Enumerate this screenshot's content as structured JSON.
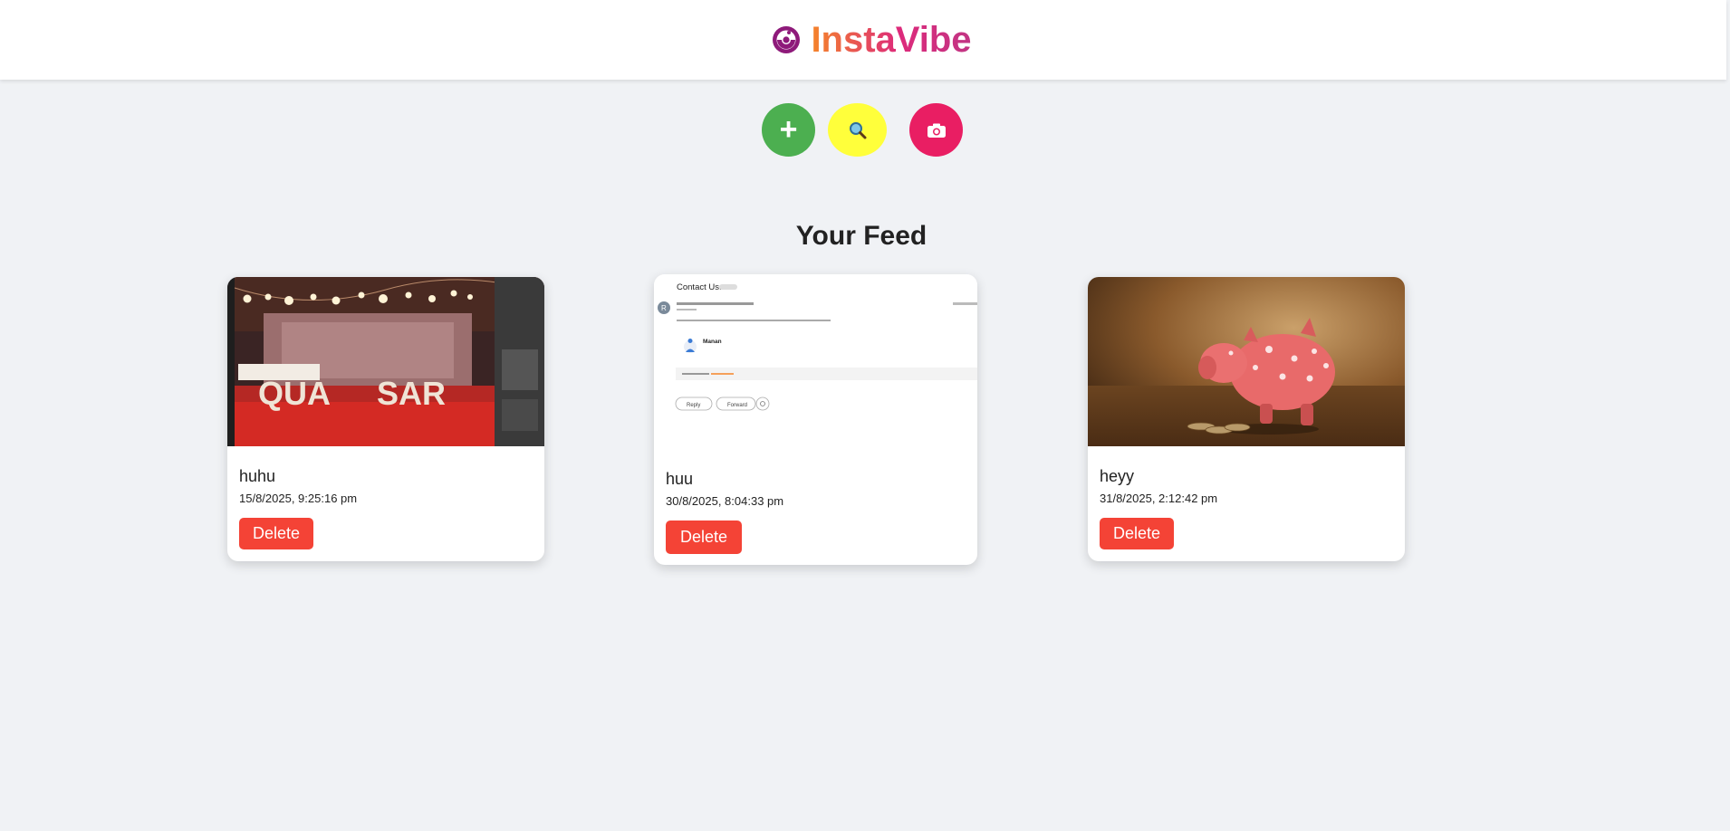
{
  "header": {
    "brand_name": "InstaVibe",
    "brand_icon": "instavibe-logo-icon"
  },
  "actions": [
    {
      "name": "add-post-button",
      "icon": "plus-icon",
      "label": "+",
      "color": "#4caf50"
    },
    {
      "name": "search-button",
      "icon": "search-icon",
      "color": "#ffff3b"
    },
    {
      "name": "camera-button",
      "icon": "camera-icon",
      "color": "#e91e63"
    }
  ],
  "feed": {
    "title": "Your Feed",
    "posts": [
      {
        "caption": "huhu",
        "timestamp": "15/8/2025, 9:25:16 pm",
        "delete_label": "Delete",
        "image": "event-stage-photo"
      },
      {
        "caption": "huu",
        "timestamp": "30/8/2025, 8:04:33 pm",
        "delete_label": "Delete",
        "image": "email-screenshot",
        "image_text": {
          "heading": "Contact Us:",
          "avatar_letter": "R",
          "sender": "Manan",
          "reply": "Reply",
          "forward": "Forward"
        }
      },
      {
        "caption": "heyy",
        "timestamp": "31/8/2025, 2:12:42 pm",
        "delete_label": "Delete",
        "image": "piggy-bank-photo"
      }
    ]
  },
  "colors": {
    "delete": "#f44336",
    "background": "#f0f2f5",
    "brand_gradient": [
      "#f58529",
      "#dd2a7b",
      "#c13584"
    ]
  }
}
